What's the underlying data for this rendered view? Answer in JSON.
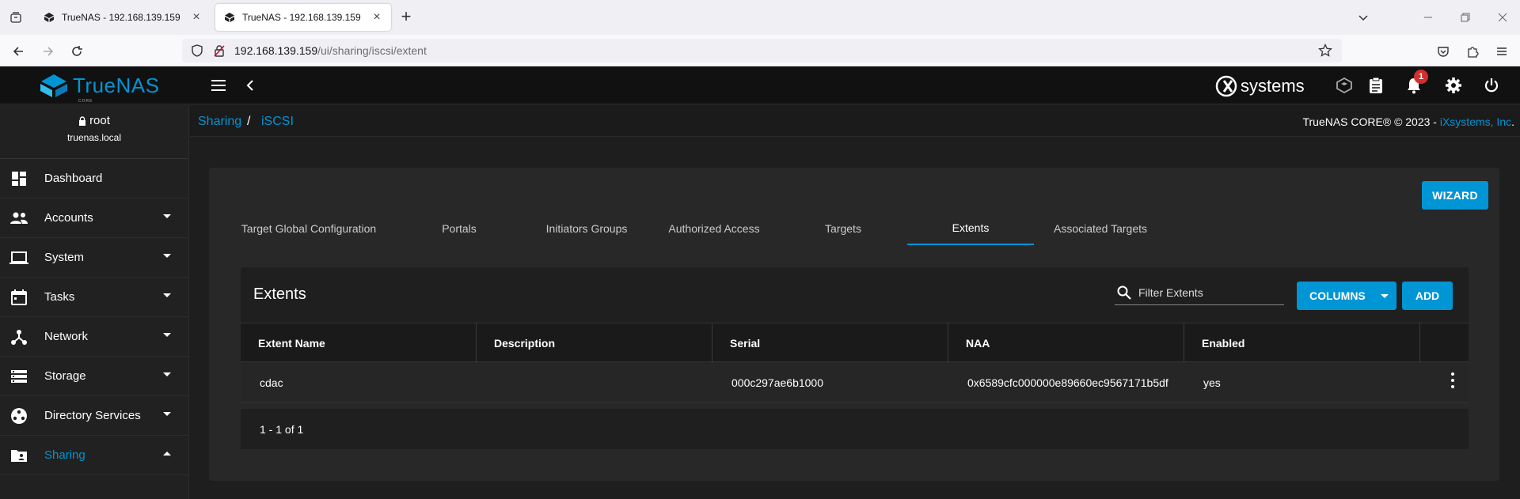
{
  "browser": {
    "tabs": [
      {
        "title": "TrueNAS - 192.168.139.159",
        "active": false
      },
      {
        "title": "TrueNAS - 192.168.139.159",
        "active": true
      }
    ],
    "url_host": "192.168.139.159",
    "url_path": "/ui/sharing/iscsi/extent"
  },
  "header": {
    "logo_text": "TrueNAS",
    "logo_sub": "CORE",
    "brand": "systems",
    "notification_count": "1"
  },
  "sidebar": {
    "user": "root",
    "hostname": "truenas.local",
    "items": [
      {
        "label": "Dashboard"
      },
      {
        "label": "Accounts"
      },
      {
        "label": "System"
      },
      {
        "label": "Tasks"
      },
      {
        "label": "Network"
      },
      {
        "label": "Storage"
      },
      {
        "label": "Directory Services"
      },
      {
        "label": "Sharing"
      }
    ]
  },
  "breadcrumb": {
    "items": [
      "Sharing",
      "iSCSI"
    ],
    "separator": "/"
  },
  "copyright": {
    "text": "TrueNAS CORE® © 2023 - ",
    "link": "iXsystems, Inc",
    "suffix": "."
  },
  "page": {
    "wizard_label": "WIZARD",
    "tabs": [
      "Target Global Configuration",
      "Portals",
      "Initiators Groups",
      "Authorized Access",
      "Targets",
      "Extents",
      "Associated Targets"
    ],
    "active_tab": "Extents"
  },
  "table": {
    "title": "Extents",
    "filter_placeholder": "Filter Extents",
    "columns_label": "COLUMNS",
    "add_label": "ADD",
    "headers": [
      "Extent Name",
      "Description",
      "Serial",
      "NAA",
      "Enabled"
    ],
    "rows": [
      [
        "cdac",
        "",
        "000c297ae6b1000",
        "0x6589cfc000000e89660ec9567171b5df",
        "yes"
      ]
    ],
    "pagination": "1 - 1 of 1"
  },
  "colors": {
    "accent": "#0095d5",
    "background": "#1e1e1e",
    "header": "#111111",
    "badge": "#d32f2f"
  }
}
